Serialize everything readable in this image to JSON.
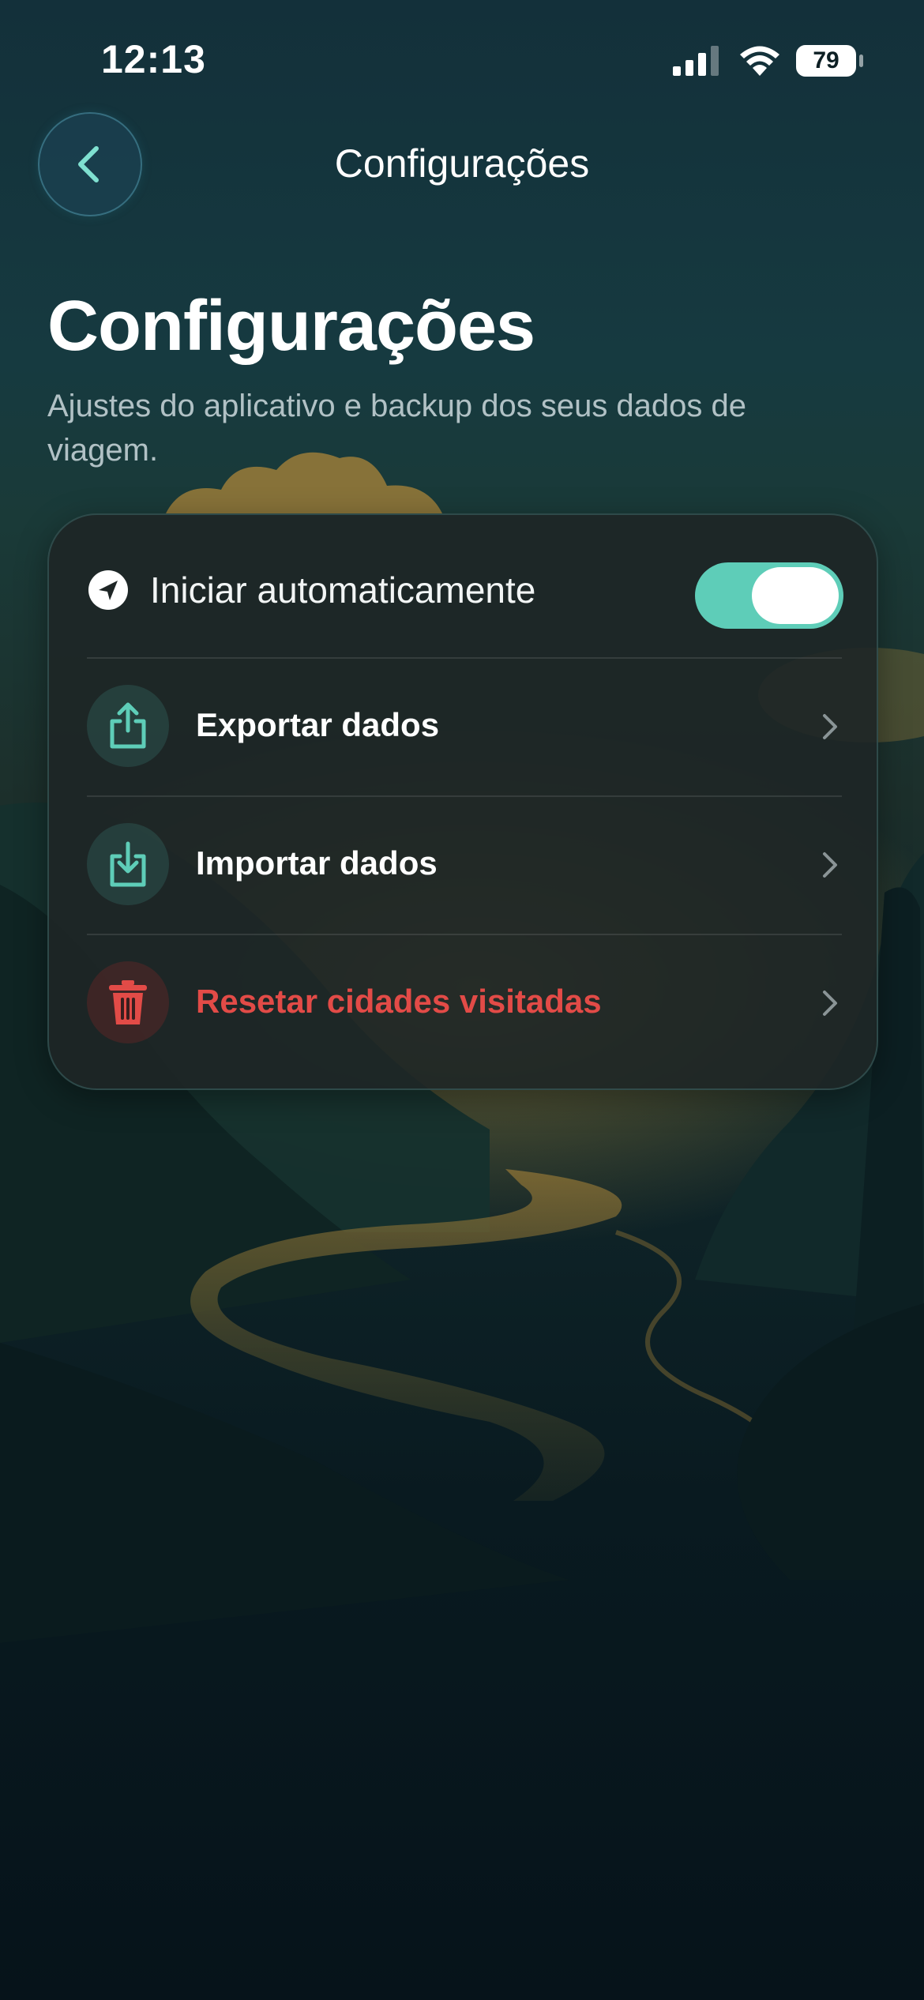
{
  "status_bar": {
    "time": "12:13",
    "battery": "79",
    "icons": [
      "signal-icon",
      "wifi-icon",
      "battery-icon"
    ]
  },
  "nav": {
    "title": "Configurações",
    "back_icon": "chevron-left-icon"
  },
  "header": {
    "title": "Configurações",
    "subtitle": "Ajustes do aplicativo e backup dos seus dados de viagem."
  },
  "settings": {
    "autostart": {
      "label": "Iniciar automaticamente",
      "icon": "location-arrow-icon",
      "enabled": true
    },
    "items": [
      {
        "label": "Exportar dados",
        "icon": "export-icon"
      },
      {
        "label": "Importar dados",
        "icon": "import-icon"
      },
      {
        "label": "Resetar cidades visitadas",
        "icon": "trash-icon",
        "destructive": true
      }
    ]
  },
  "colors": {
    "accent": "#5ecdb8",
    "danger": "#e24b47",
    "card": "#1e2626"
  }
}
